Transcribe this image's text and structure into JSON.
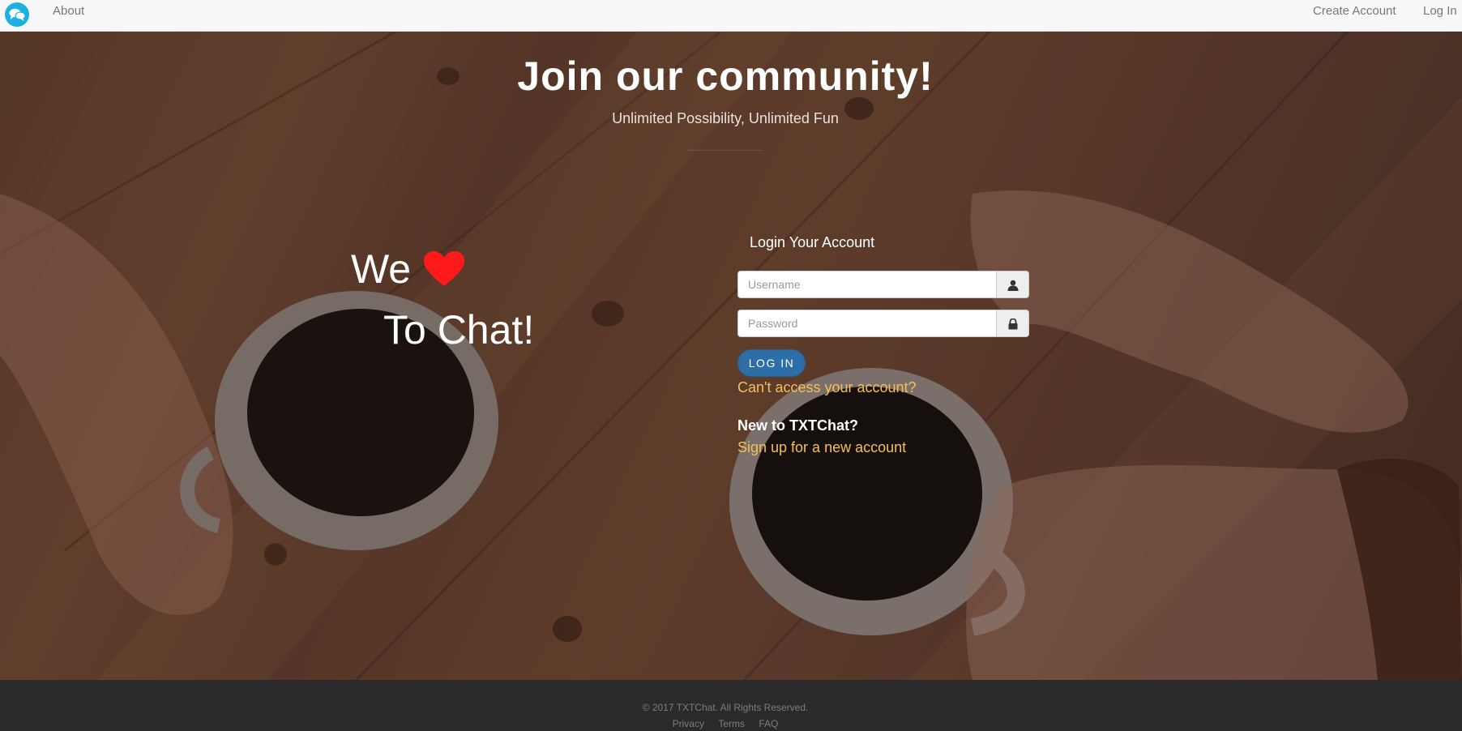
{
  "navbar": {
    "logo_icon": "chat-bubbles-icon",
    "about_label": "About",
    "create_account_label": "Create Account",
    "login_label": "Log In"
  },
  "hero": {
    "title": "Join our community!",
    "subtitle": "Unlimited Possibility, Unlimited Fun",
    "slogan_line1": "We",
    "slogan_icon": "heart-icon",
    "slogan_line2": "To Chat!"
  },
  "login": {
    "heading": "Login Your Account",
    "username_placeholder": "Username",
    "username_icon": "user-icon",
    "password_placeholder": "Password",
    "password_icon": "lock-icon",
    "button_label": "LOG IN",
    "forgot_label": "Can't access your account?",
    "new_user_heading": "New to TXTChat?",
    "signup_label": "Sign up for a new account"
  },
  "footer": {
    "copyright": "© 2017 TXTChat. All Rights Reserved.",
    "links": [
      "Privacy",
      "Terms",
      "FAQ"
    ]
  },
  "colors": {
    "brand": "#1ab0e0",
    "heart": "#ff1a1a",
    "link": "#f2c05a",
    "button": "#2b6ea8"
  }
}
